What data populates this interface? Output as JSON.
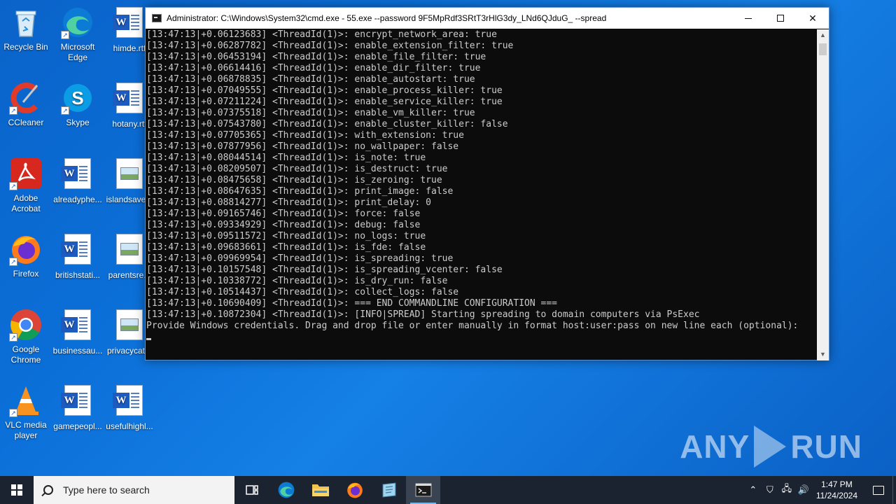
{
  "desktop": {
    "icons": [
      {
        "label": "Recycle Bin"
      },
      {
        "label": "Microsoft Edge"
      },
      {
        "label": "himde.rtf"
      },
      {
        "label": "CCleaner"
      },
      {
        "label": "Skype"
      },
      {
        "label": "hotany.rtf"
      },
      {
        "label": "Adobe Acrobat"
      },
      {
        "label": "alreadyphe..."
      },
      {
        "label": "islandsave..."
      },
      {
        "label": "Firefox"
      },
      {
        "label": "britishstati..."
      },
      {
        "label": "parentsre..."
      },
      {
        "label": "Google Chrome"
      },
      {
        "label": "businessau..."
      },
      {
        "label": "privacycat..."
      },
      {
        "label": "VLC media player"
      },
      {
        "label": "gamepeopl..."
      },
      {
        "label": "usefulhighl..."
      }
    ]
  },
  "cmd": {
    "title": "Administrator: C:\\Windows\\System32\\cmd.exe - 55.exe  --password 9F5MpRdf3SRtT3rHlG3dy_LNd6QJduG_ --spread",
    "lines": [
      "[13:47:13|+0.06123683] <ThreadId(1)>: encrypt_network_area: true",
      "[13:47:13|+0.06287782] <ThreadId(1)>: enable_extension_filter: true",
      "[13:47:13|+0.06453194] <ThreadId(1)>: enable_file_filter: true",
      "[13:47:13|+0.06614416] <ThreadId(1)>: enable_dir_filter: true",
      "[13:47:13|+0.06878835] <ThreadId(1)>: enable_autostart: true",
      "[13:47:13|+0.07049555] <ThreadId(1)>: enable_process_killer: true",
      "[13:47:13|+0.07211224] <ThreadId(1)>: enable_service_killer: true",
      "[13:47:13|+0.07375518] <ThreadId(1)>: enable_vm_killer: true",
      "[13:47:13|+0.07543780] <ThreadId(1)>: enable_cluster_killer: false",
      "[13:47:13|+0.07705365] <ThreadId(1)>: with_extension: true",
      "[13:47:13|+0.07877956] <ThreadId(1)>: no_wallpaper: false",
      "[13:47:13|+0.08044514] <ThreadId(1)>: is_note: true",
      "[13:47:13|+0.08209507] <ThreadId(1)>: is_destruct: true",
      "[13:47:13|+0.08475658] <ThreadId(1)>: is_zeroing: true",
      "[13:47:13|+0.08647635] <ThreadId(1)>: print_image: false",
      "[13:47:13|+0.08814277] <ThreadId(1)>: print_delay: 0",
      "[13:47:13|+0.09165746] <ThreadId(1)>: force: false",
      "[13:47:13|+0.09334929] <ThreadId(1)>: debug: false",
      "[13:47:13|+0.09511572] <ThreadId(1)>: no_logs: true",
      "[13:47:13|+0.09683661] <ThreadId(1)>: is_fde: false",
      "[13:47:13|+0.09969954] <ThreadId(1)>: is_spreading: true",
      "[13:47:13|+0.10157548] <ThreadId(1)>: is_spreading_vcenter: false",
      "[13:47:13|+0.10338772] <ThreadId(1)>: is_dry_run: false",
      "[13:47:13|+0.10514437] <ThreadId(1)>: collect_logs: false",
      "[13:47:13|+0.10690409] <ThreadId(1)>: === END COMMANDLINE CONFIGURATION ===",
      "[13:47:13|+0.10872304] <ThreadId(1)>: [INFO|SPREAD] Starting spreading to domain computers via PsExec",
      "Provide Windows credentials. Drag and drop file or enter manually in format host:user:pass on new line each (optional):"
    ]
  },
  "watermark": {
    "left": "ANY",
    "right": "RUN"
  },
  "taskbar": {
    "search_placeholder": "Type here to search",
    "time": "1:47 PM",
    "date": "11/24/2024"
  },
  "colors": {
    "desktop_bg": "#0b6fd8",
    "console_bg": "#0c0c0c",
    "console_text": "#cccccc",
    "taskbar_bg": "#1b2330",
    "accent": "#76b9ed"
  }
}
